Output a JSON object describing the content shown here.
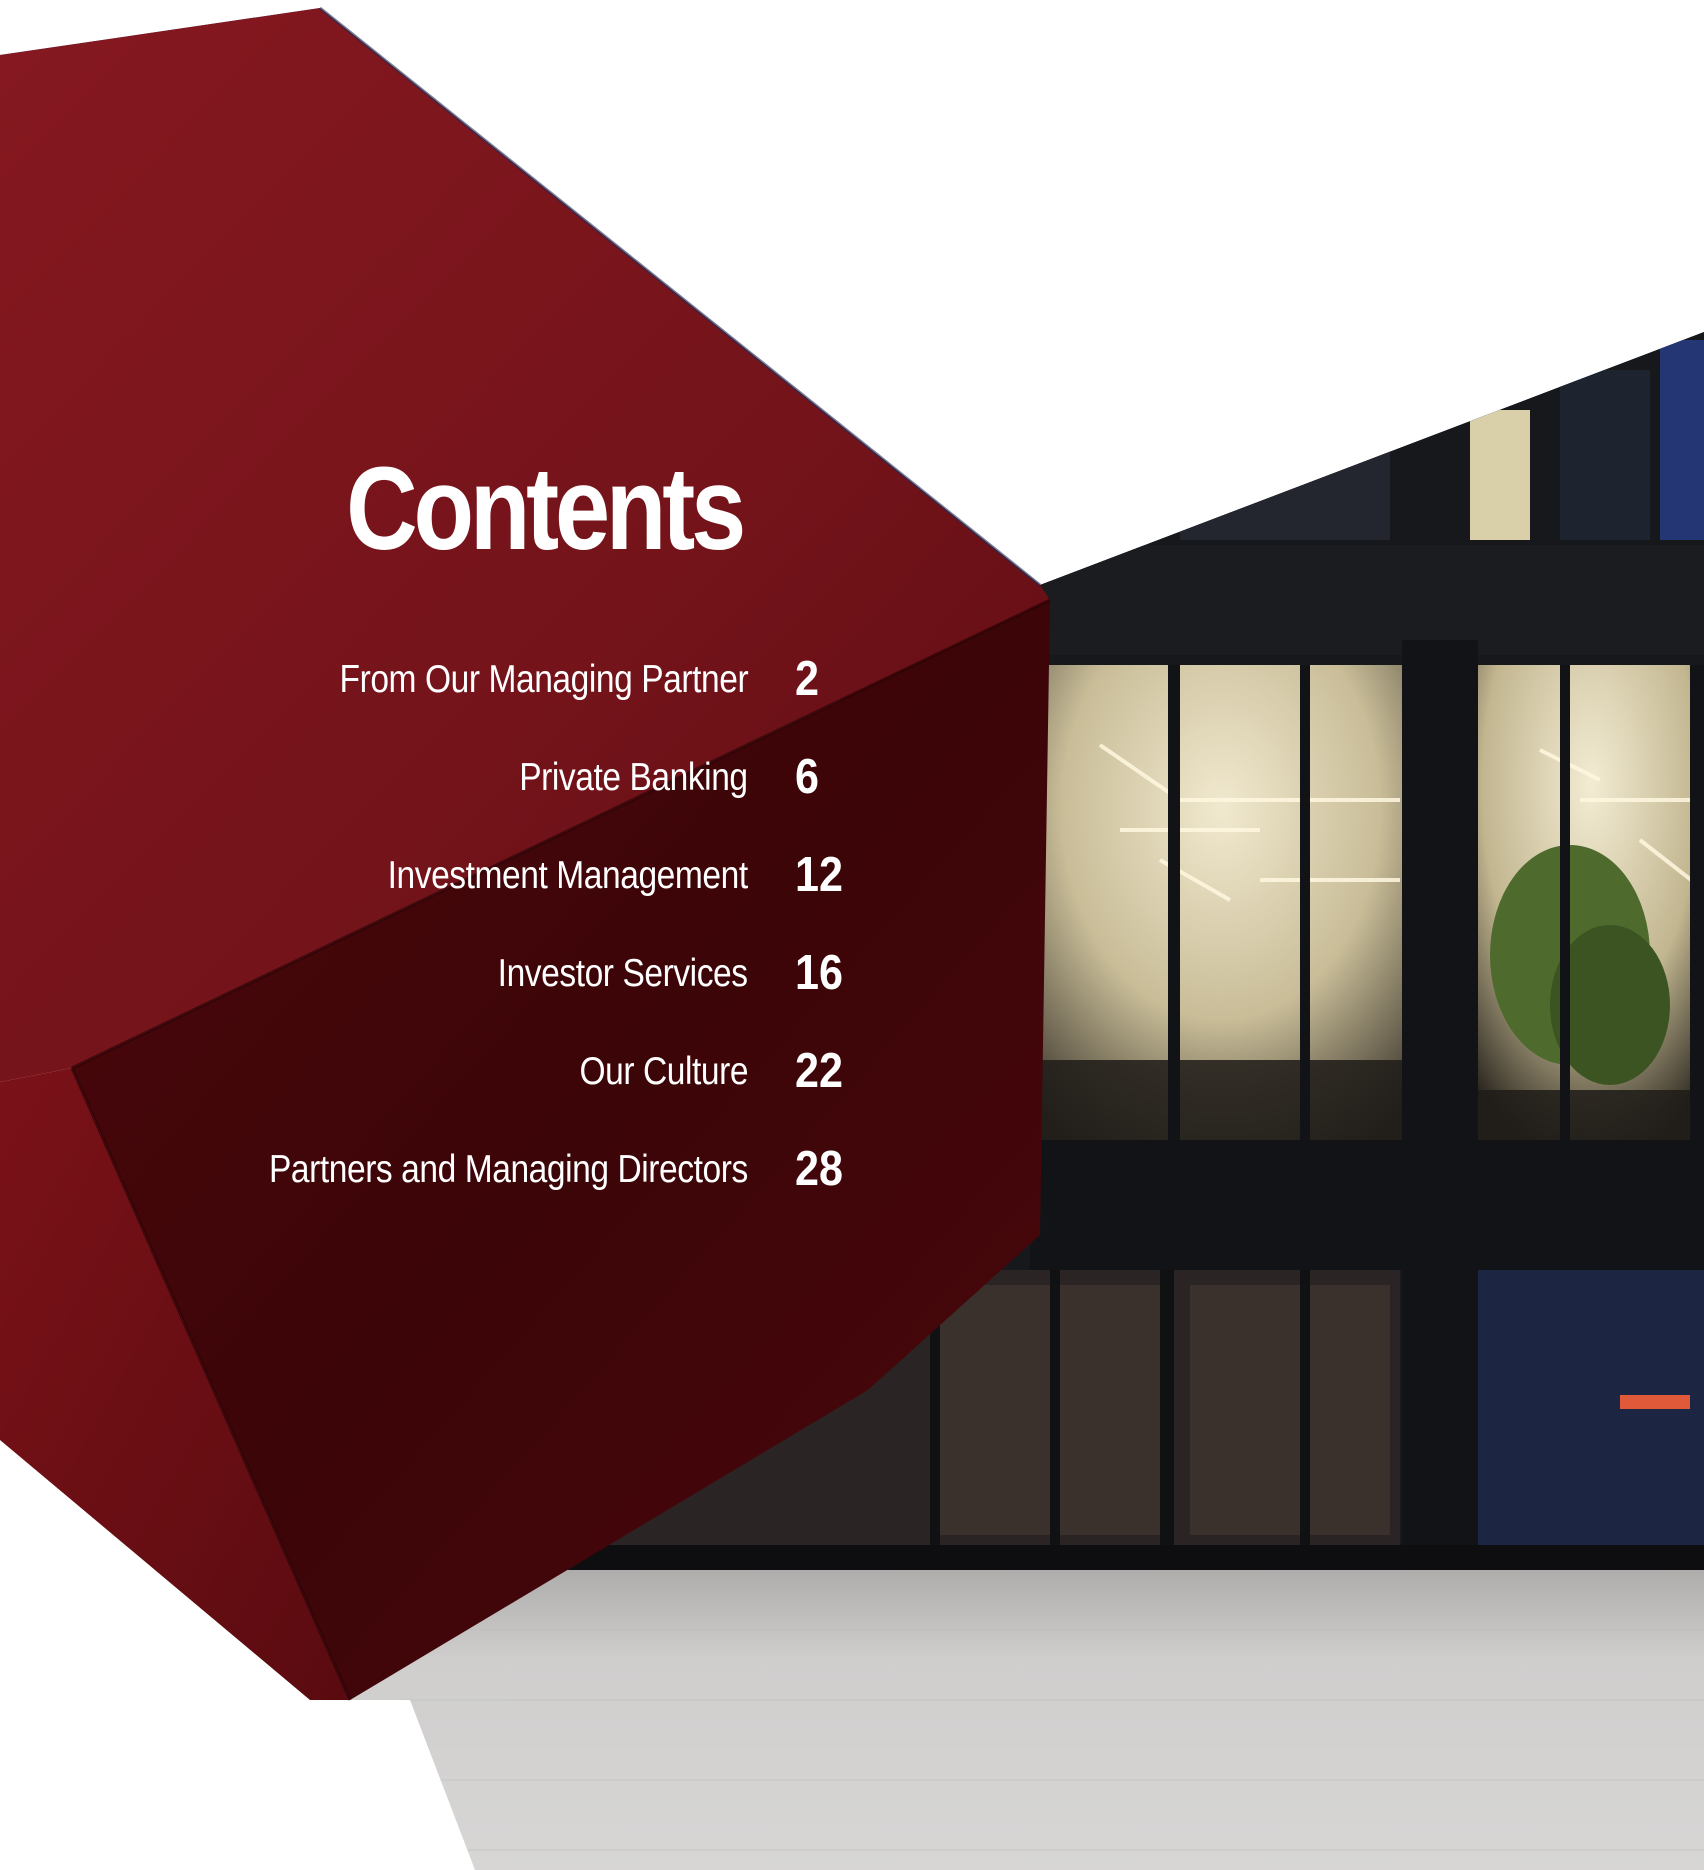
{
  "contents": {
    "title": "Contents",
    "entries": [
      {
        "label": "From Our Managing Partner",
        "page": "2"
      },
      {
        "label": "Private Banking",
        "page": "6"
      },
      {
        "label": "Investment Management",
        "page": "12"
      },
      {
        "label": "Investor Services",
        "page": "16"
      },
      {
        "label": "Our Culture",
        "page": "22"
      },
      {
        "label": "Partners and Managing Directors",
        "page": "28"
      }
    ]
  },
  "colors": {
    "red_sculpture": "#7a1419",
    "red_shadow": "#3d0608",
    "building_dark": "#16171b",
    "plaza": "#c8c7c6",
    "night_sky": "#1a2a55",
    "interior_light": "#e6dcbd"
  }
}
